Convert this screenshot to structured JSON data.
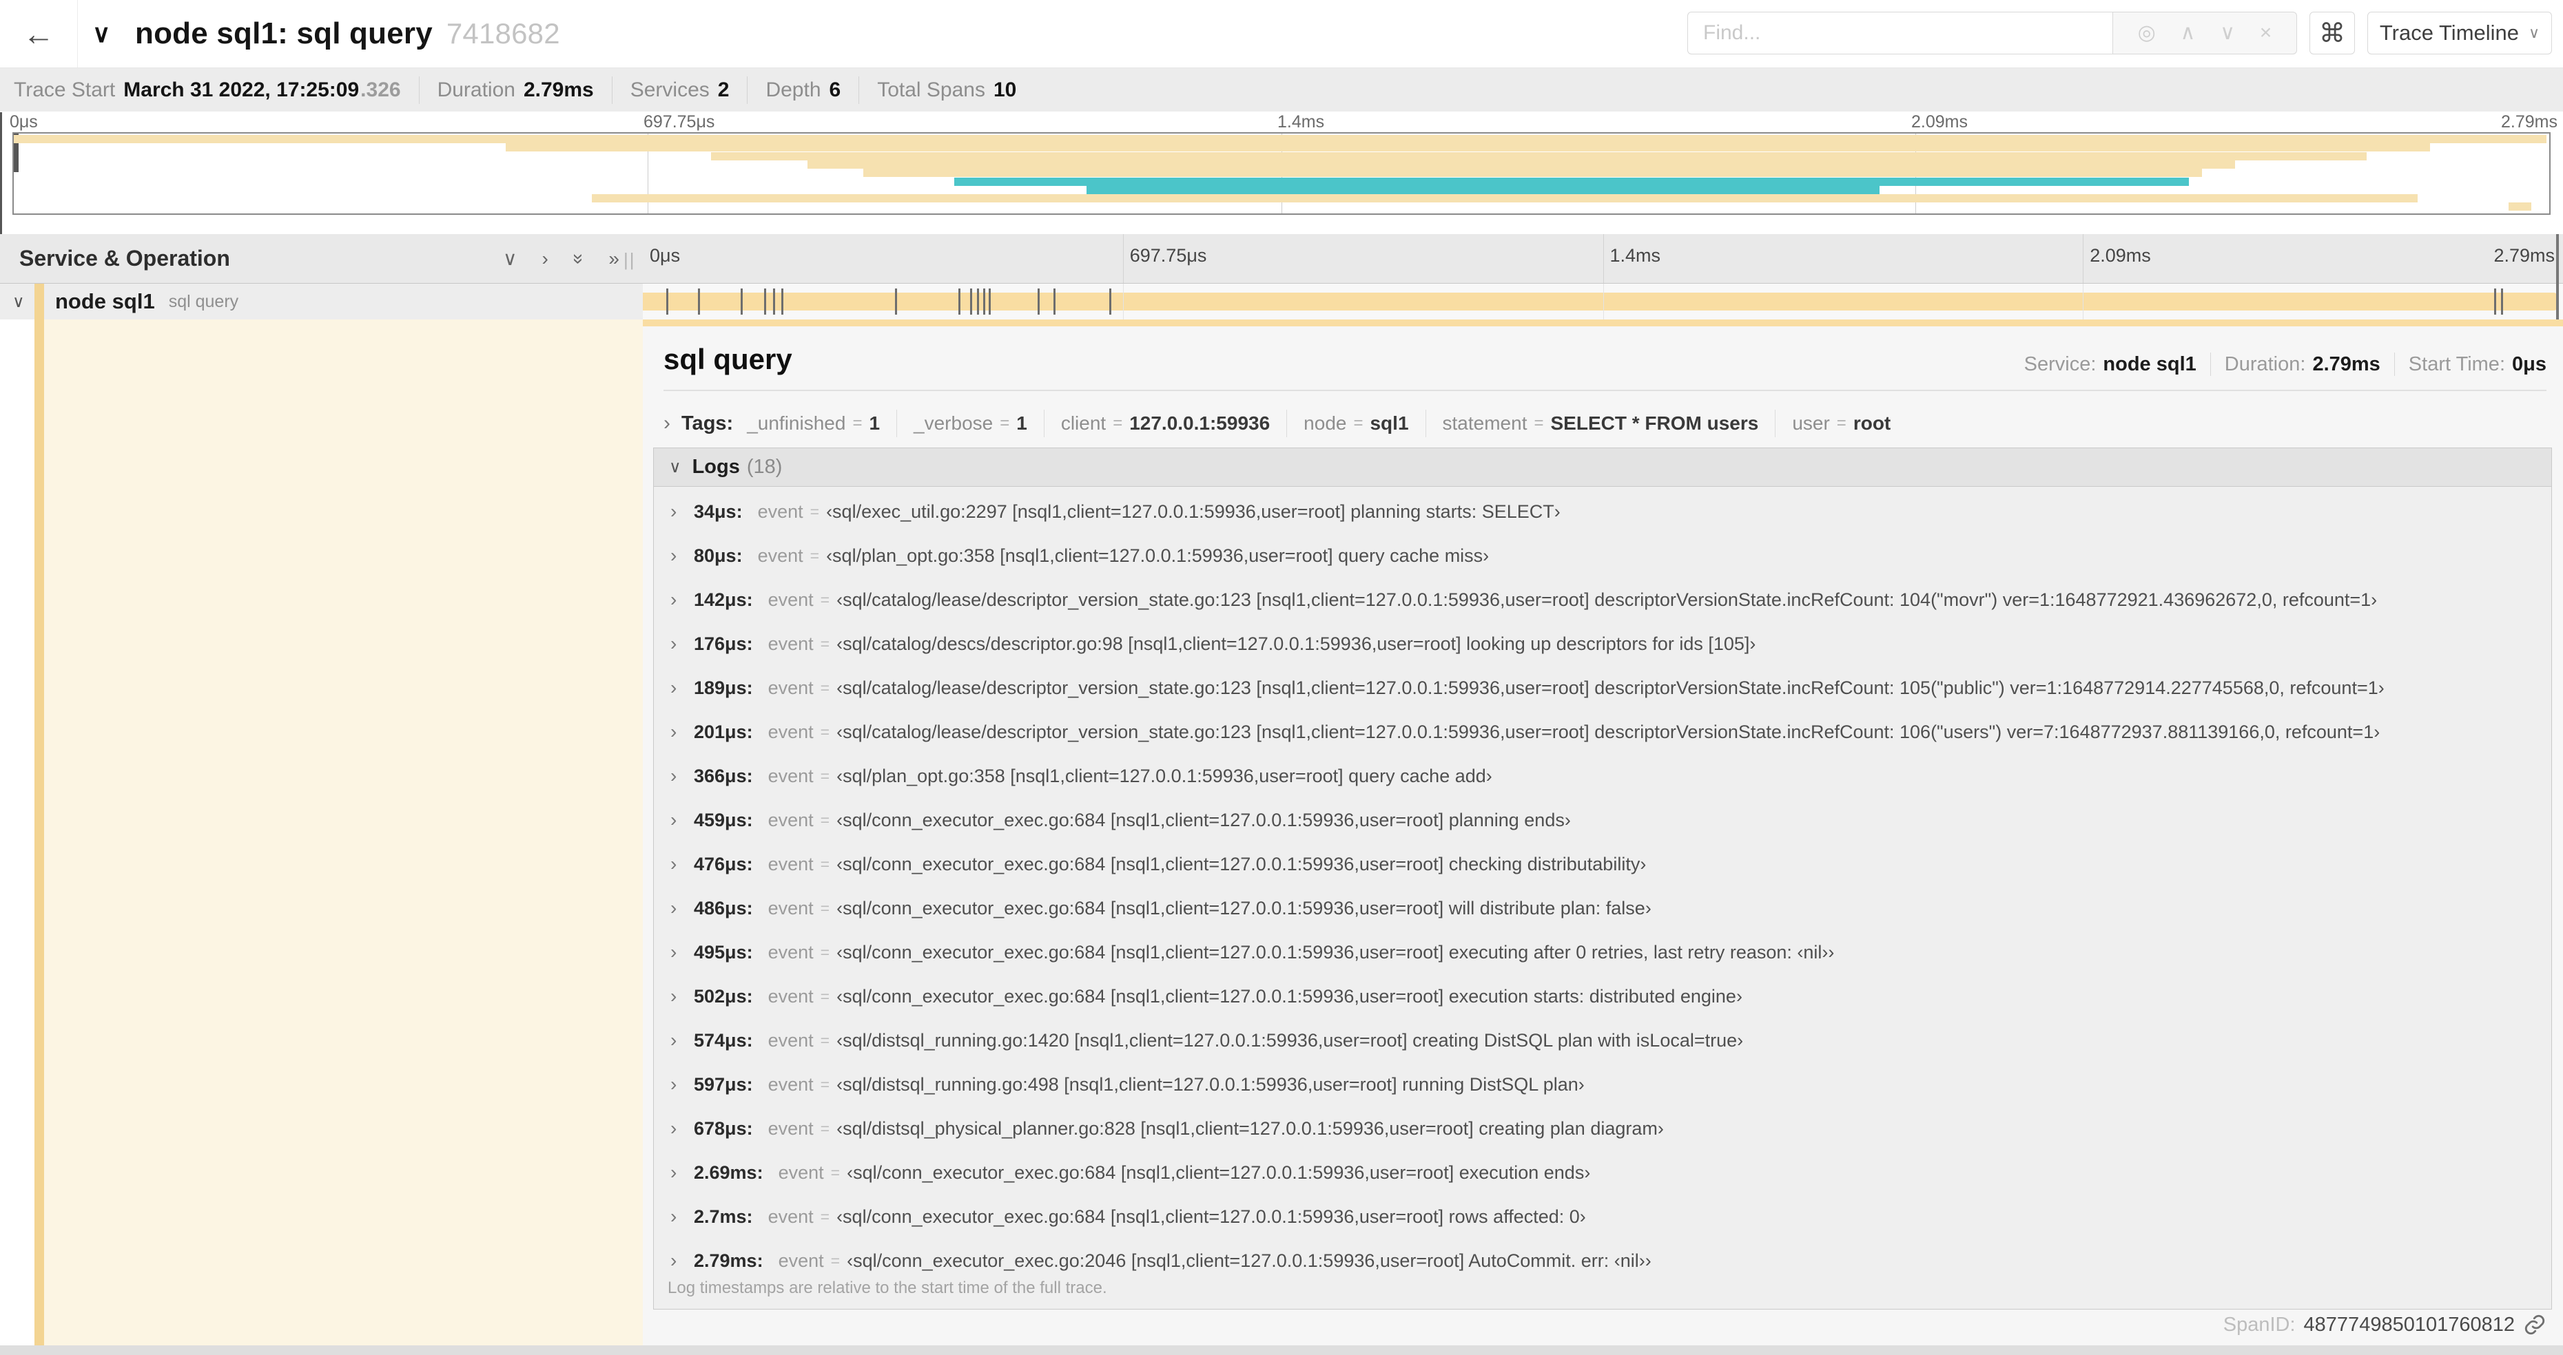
{
  "header": {
    "back_icon": "←",
    "collapse_icon": "∨",
    "title": "node sql1: sql query",
    "trace_id": "7418682",
    "find_placeholder": "Find...",
    "find_icons": [
      "◎",
      "∧",
      "∨",
      "×"
    ],
    "kbd_icon": "⌘",
    "view_selector": "Trace Timeline",
    "view_chevron": "∨"
  },
  "trace_meta": {
    "trace_start_label": "Trace Start",
    "trace_start_value": "March 31 2022, 17:25:09",
    "trace_start_fraction": ".326",
    "duration_label": "Duration",
    "duration_value": "2.79ms",
    "services_label": "Services",
    "services_value": "2",
    "depth_label": "Depth",
    "depth_value": "6",
    "total_spans_label": "Total Spans",
    "total_spans_value": "10"
  },
  "colors": {
    "tan": "#f9dda2",
    "tan_light": "#f6e1b0",
    "teal": "#4bc5c9",
    "stripe": "#f3d492"
  },
  "chart_data": {
    "type": "area",
    "title": "trace minimap span rows (fraction of 2.79ms trace duration, %)",
    "x": [
      "start_pct",
      "end_pct"
    ],
    "series": [
      {
        "name": "span-1",
        "color": "tan",
        "values": [
          0,
          99.9
        ]
      },
      {
        "name": "span-2",
        "color": "tan",
        "values": [
          19.4,
          95.3
        ]
      },
      {
        "name": "span-3",
        "color": "tan",
        "values": [
          27.5,
          92.8
        ]
      },
      {
        "name": "span-4",
        "color": "tan",
        "values": [
          31.3,
          87.6
        ]
      },
      {
        "name": "span-5",
        "color": "tan",
        "values": [
          33.5,
          86.3
        ]
      },
      {
        "name": "span-6",
        "color": "teal",
        "values": [
          37.1,
          85.8
        ]
      },
      {
        "name": "span-7",
        "color": "teal",
        "values": [
          42.3,
          73.6
        ]
      },
      {
        "name": "span-8",
        "color": "tan",
        "values": [
          22.8,
          94.8
        ]
      },
      {
        "name": "span-9",
        "color": "tan",
        "values": [
          98.4,
          99.3
        ]
      }
    ]
  },
  "minimap": {
    "tick_pcts": [
      0,
      25,
      50,
      75,
      100
    ],
    "tick_labels": [
      "0μs",
      "697.75μs",
      "1.4ms",
      "2.09ms",
      "2.79ms"
    ]
  },
  "timeline": {
    "header_label": "Service & Operation",
    "header_icons": [
      "∨",
      "›",
      "»down",
      "»"
    ],
    "grip": "||",
    "tick_pcts": [
      0,
      25,
      50,
      75,
      100
    ],
    "tick_labels": [
      "0μs",
      "697.75μs",
      "1.4ms",
      "2.09ms",
      "2.79ms"
    ]
  },
  "span_row": {
    "chevron": "∨",
    "service": "node sql1",
    "operation": "sql query",
    "log_marker_pcts": [
      1.22,
      2.87,
      5.09,
      6.31,
      6.77,
      7.2,
      13.12,
      16.45,
      17.06,
      17.42,
      17.74,
      18.0,
      20.57,
      21.4,
      24.3,
      96.42,
      96.77
    ]
  },
  "detail": {
    "title": "sql query",
    "service_label": "Service:",
    "service_value": "node sql1",
    "duration_label": "Duration:",
    "duration_value": "2.79ms",
    "start_label": "Start Time:",
    "start_value": "0μs",
    "tags_chevron": "›",
    "tags_label": "Tags:",
    "tags": [
      {
        "key": "_unfinished",
        "value": "1"
      },
      {
        "key": "_verbose",
        "value": "1"
      },
      {
        "key": "client",
        "value": "127.0.0.1:59936"
      },
      {
        "key": "node",
        "value": "sql1"
      },
      {
        "key": "statement",
        "value": "SELECT * FROM users"
      },
      {
        "key": "user",
        "value": "root"
      }
    ],
    "logs_chevron": "∨",
    "logs_label": "Logs",
    "logs_count": "(18)",
    "log_field": "event",
    "logs": [
      {
        "time": "34μs:",
        "value": "‹sql/exec_util.go:2297 [nsql1,client=127.0.0.1:59936,user=root] planning starts: SELECT›"
      },
      {
        "time": "80μs:",
        "value": "‹sql/plan_opt.go:358 [nsql1,client=127.0.0.1:59936,user=root] query cache miss›"
      },
      {
        "time": "142μs:",
        "value": "‹sql/catalog/lease/descriptor_version_state.go:123 [nsql1,client=127.0.0.1:59936,user=root] descriptorVersionState.incRefCount: 104(\"movr\") ver=1:1648772921.436962672,0, refcount=1›"
      },
      {
        "time": "176μs:",
        "value": "‹sql/catalog/descs/descriptor.go:98 [nsql1,client=127.0.0.1:59936,user=root] looking up descriptors for ids [105]›"
      },
      {
        "time": "189μs:",
        "value": "‹sql/catalog/lease/descriptor_version_state.go:123 [nsql1,client=127.0.0.1:59936,user=root] descriptorVersionState.incRefCount: 105(\"public\") ver=1:1648772914.227745568,0, refcount=1›"
      },
      {
        "time": "201μs:",
        "value": "‹sql/catalog/lease/descriptor_version_state.go:123 [nsql1,client=127.0.0.1:59936,user=root] descriptorVersionState.incRefCount: 106(\"users\") ver=7:1648772937.881139166,0, refcount=1›"
      },
      {
        "time": "366μs:",
        "value": "‹sql/plan_opt.go:358 [nsql1,client=127.0.0.1:59936,user=root] query cache add›"
      },
      {
        "time": "459μs:",
        "value": "‹sql/conn_executor_exec.go:684 [nsql1,client=127.0.0.1:59936,user=root] planning ends›"
      },
      {
        "time": "476μs:",
        "value": "‹sql/conn_executor_exec.go:684 [nsql1,client=127.0.0.1:59936,user=root] checking distributability›"
      },
      {
        "time": "486μs:",
        "value": "‹sql/conn_executor_exec.go:684 [nsql1,client=127.0.0.1:59936,user=root] will distribute plan: false›"
      },
      {
        "time": "495μs:",
        "value": "‹sql/conn_executor_exec.go:684 [nsql1,client=127.0.0.1:59936,user=root] executing after 0 retries, last retry reason: ‹nil››"
      },
      {
        "time": "502μs:",
        "value": "‹sql/conn_executor_exec.go:684 [nsql1,client=127.0.0.1:59936,user=root] execution starts: distributed engine›"
      },
      {
        "time": "574μs:",
        "value": "‹sql/distsql_running.go:1420 [nsql1,client=127.0.0.1:59936,user=root] creating DistSQL plan with isLocal=true›"
      },
      {
        "time": "597μs:",
        "value": "‹sql/distsql_running.go:498 [nsql1,client=127.0.0.1:59936,user=root] running DistSQL plan›"
      },
      {
        "time": "678μs:",
        "value": "‹sql/distsql_physical_planner.go:828 [nsql1,client=127.0.0.1:59936,user=root] creating plan diagram›"
      },
      {
        "time": "2.69ms:",
        "value": "‹sql/conn_executor_exec.go:684 [nsql1,client=127.0.0.1:59936,user=root] execution ends›"
      },
      {
        "time": "2.7ms:",
        "value": "‹sql/conn_executor_exec.go:684 [nsql1,client=127.0.0.1:59936,user=root] rows affected: 0›"
      },
      {
        "time": "2.79ms:",
        "value": "‹sql/conn_executor_exec.go:2046 [nsql1,client=127.0.0.1:59936,user=root] AutoCommit. err: ‹nil››"
      }
    ],
    "footnote": "Log timestamps are relative to the start time of the full trace.",
    "spanid_label": "SpanID:",
    "spanid_value": "4877749850101760812"
  }
}
